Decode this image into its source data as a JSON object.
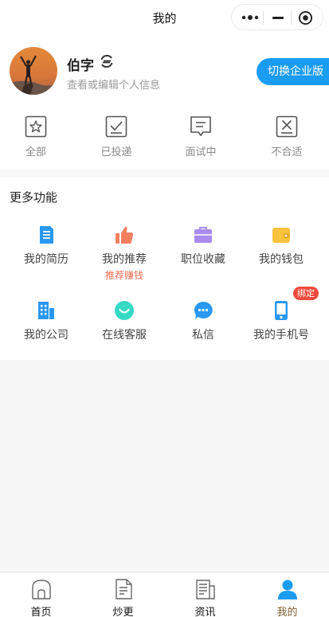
{
  "header": {
    "title": "我的"
  },
  "profile": {
    "name": "伯字",
    "subtitle": "查看或编辑个人信息",
    "switch_button": "切换企业版"
  },
  "status_tabs": [
    {
      "label": "全部",
      "icon": "star-icon"
    },
    {
      "label": "已投递",
      "icon": "check-box-icon"
    },
    {
      "label": "面试中",
      "icon": "chat-bubble-icon"
    },
    {
      "label": "不合适",
      "icon": "x-box-icon"
    }
  ],
  "more": {
    "title": "更多功能",
    "items": [
      {
        "label": "我的简历",
        "icon": "resume-icon",
        "color": "#2a98f0"
      },
      {
        "label": "我的推荐",
        "sub": "推荐赚钱",
        "icon": "thumbs-up-icon",
        "color": "#f47f5f"
      },
      {
        "label": "职位收藏",
        "icon": "briefcase-icon",
        "color": "#a98bf0"
      },
      {
        "label": "我的钱包",
        "icon": "wallet-icon",
        "color": "#fbc23d"
      },
      {
        "label": "我的公司",
        "icon": "building-icon",
        "color": "#2a98f0"
      },
      {
        "label": "在线客服",
        "icon": "smile-icon",
        "color": "#36d9c4"
      },
      {
        "label": "私信",
        "icon": "message-icon",
        "color": "#2a98f0"
      },
      {
        "label": "我的手机号",
        "icon": "phone-icon",
        "color": "#2a98f0",
        "badge": "绑定"
      }
    ]
  },
  "tabbar": {
    "items": [
      {
        "label": "首页",
        "icon": "home-icon"
      },
      {
        "label": "炒更",
        "icon": "document-icon"
      },
      {
        "label": "资讯",
        "icon": "news-icon"
      },
      {
        "label": "我的",
        "icon": "user-icon",
        "active": true
      }
    ]
  },
  "colors": {
    "accent": "#1a9cf3",
    "badge": "#ef4a3c",
    "recommend_text": "#f26b4d",
    "active_tab": "#7a5a2a"
  }
}
